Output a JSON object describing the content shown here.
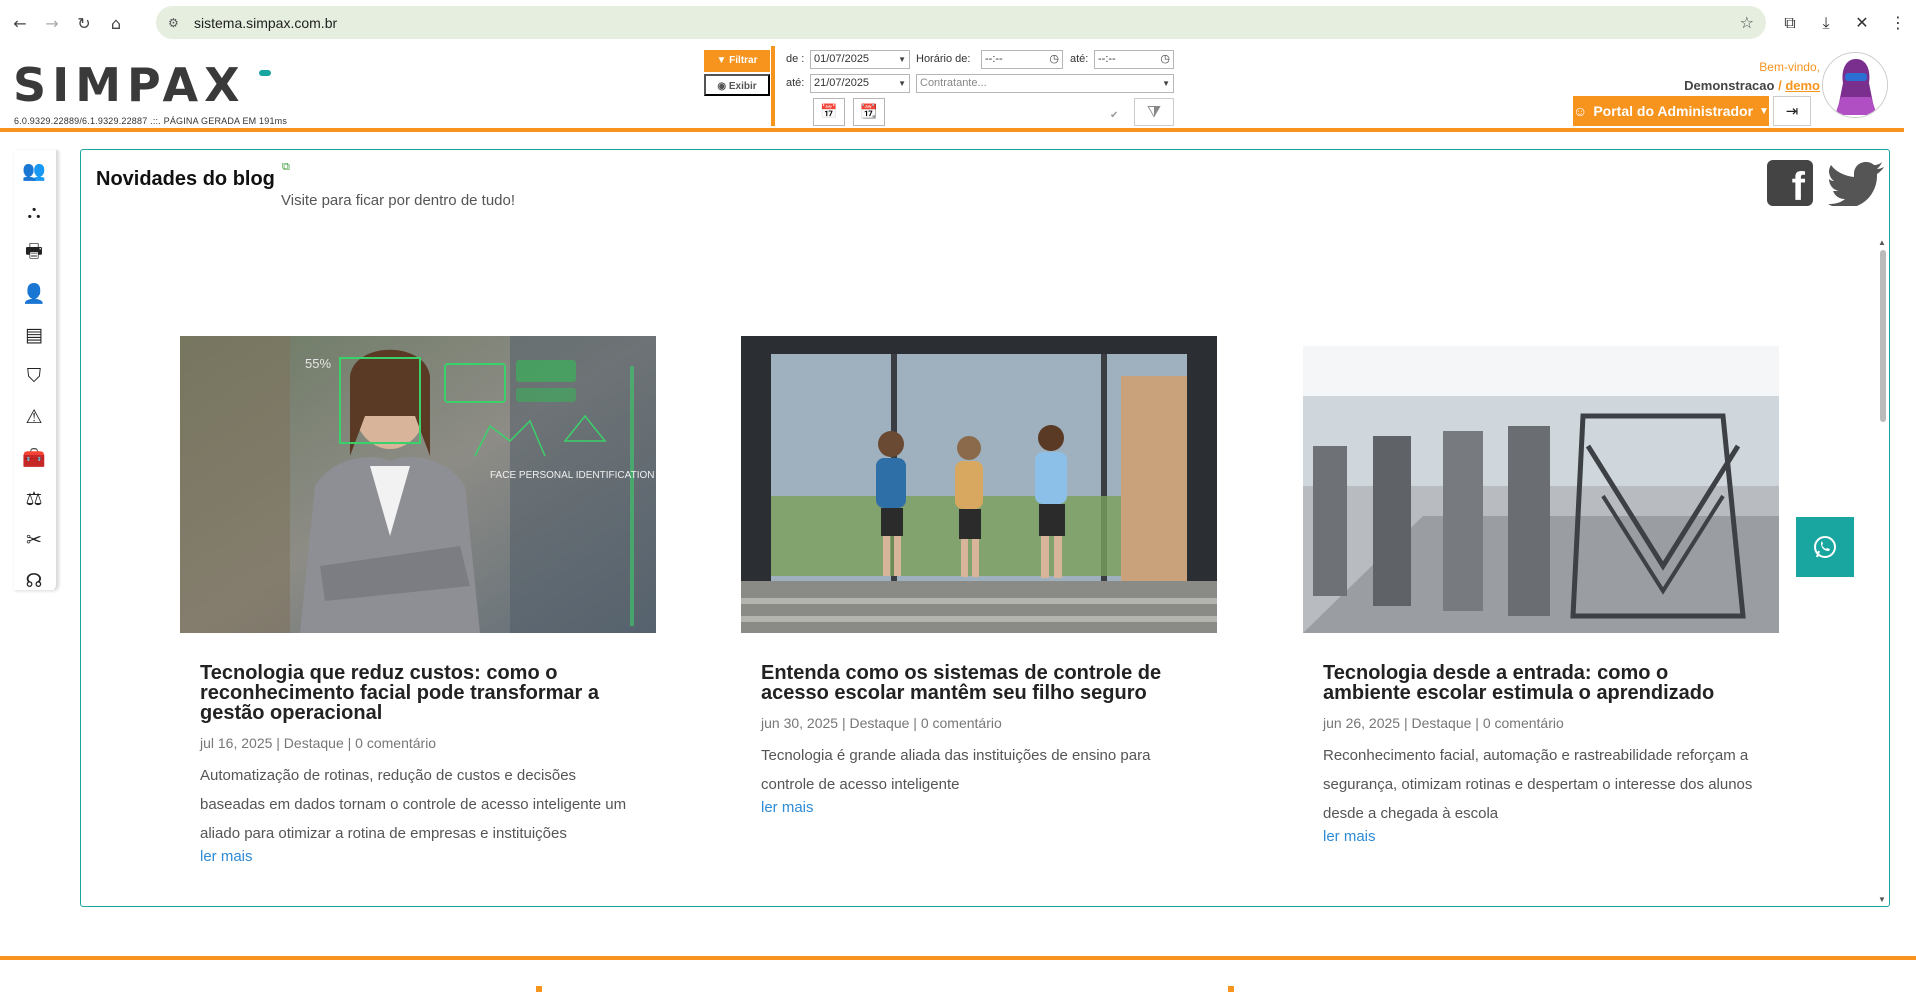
{
  "browser": {
    "url": "sistema.simpax.com.br"
  },
  "header": {
    "logo_text": "SIMPAX",
    "version": "6.0.9329.22889/6.1.9329.22887 .::. PÁGINA GERADA EM 191ms",
    "filter_button": "Filtrar",
    "show_button": "Exibir",
    "date_from_label": "de :",
    "date_from_value": "01/07/2025",
    "date_to_label": "até:",
    "date_to_value": "21/07/2025",
    "time_from_label": "Horário de:",
    "time_from_value": "--:--",
    "time_to_label": "até:",
    "time_to_value": "--:--",
    "contractor_placeholder": "Contratante...",
    "welcome": "Bem-vindo,",
    "user_name": "Demonstracao",
    "user_separator": "/",
    "user_login": "demo",
    "portal_button": "Portal do Administrador"
  },
  "sidebar": {
    "items": [
      {
        "name": "people-icon",
        "glyph": "👥"
      },
      {
        "name": "hierarchy-icon",
        "glyph": "⛬"
      },
      {
        "name": "printer-icon",
        "glyph": "🖶"
      },
      {
        "name": "user-clock-icon",
        "glyph": "👤"
      },
      {
        "name": "barrier-icon",
        "glyph": "▤"
      },
      {
        "name": "shield-icon",
        "glyph": "⛉"
      },
      {
        "name": "warning-icon",
        "glyph": "⚠"
      },
      {
        "name": "toolbox-icon",
        "glyph": "🧰"
      },
      {
        "name": "scales-icon",
        "glyph": "⚖"
      },
      {
        "name": "tools-icon",
        "glyph": "✂"
      },
      {
        "name": "support-icon",
        "glyph": "☊"
      }
    ]
  },
  "blog": {
    "title": "Novidades do blog",
    "subtitle": "Visite para ficar por dentro de tudo!",
    "posts": [
      {
        "title": "Tecnologia que reduz custos: como o reconhecimento facial pode transformar a gestão operacional",
        "meta": "jul 16, 2025 | Destaque | 0 comentário",
        "excerpt": "Automatização de rotinas, redução de custos e decisões baseadas em dados tornam o controle de acesso inteligente um aliado para otimizar a rotina de empresas e instituições",
        "more": "ler mais",
        "image_text_1": "55%",
        "image_text_2": "FACE PERSONAL IDENTIFICATION"
      },
      {
        "title": "Entenda como os sistemas de controle de acesso escolar mantêm seu filho seguro",
        "meta": "jun 30, 2025 | Destaque | 0 comentário",
        "excerpt": "Tecnologia é grande aliada das instituições de ensino para controle de acesso inteligente",
        "more": "ler mais"
      },
      {
        "title": "Tecnologia desde a entrada: como o ambiente escolar estimula o aprendizado",
        "meta": "jun 26, 2025 | Destaque | 0 comentário",
        "excerpt": "Reconhecimento facial, automação e rastreabilidade reforçam a segurança, otimizam rotinas e despertam o interesse dos alunos desde a chegada à escola",
        "more": "ler mais"
      }
    ]
  },
  "colors": {
    "accent": "#f7941d",
    "teal": "#1aa6a0",
    "link": "#2e8bd6"
  }
}
